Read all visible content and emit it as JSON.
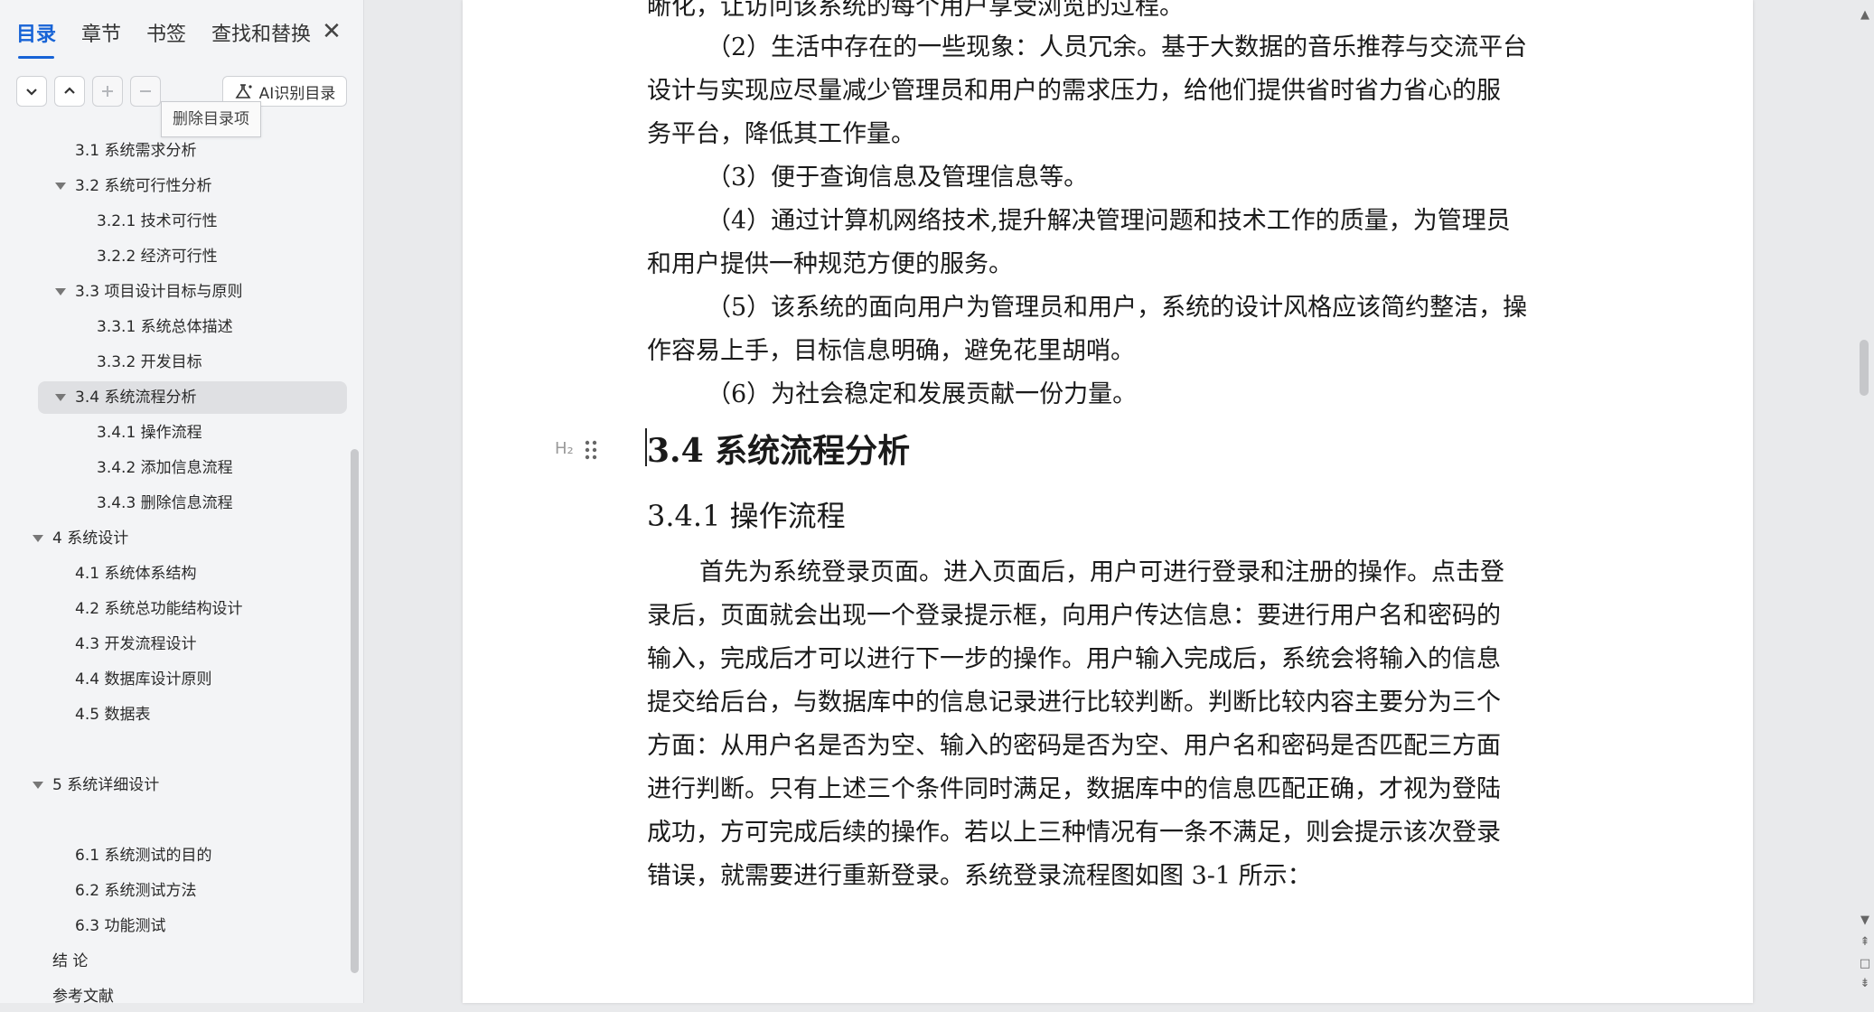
{
  "sidebar": {
    "tabs": [
      {
        "label": "目录",
        "active": true
      },
      {
        "label": "章节",
        "active": false
      },
      {
        "label": "书签",
        "active": false
      },
      {
        "label": "查找和替换",
        "active": false
      }
    ],
    "close_label": "✕",
    "ai_button_label": "AI识别目录",
    "tooltip": "删除目录项",
    "toc": [
      {
        "label": "3.1  系统需求分析",
        "level": 2,
        "has_arrow": false
      },
      {
        "label": "3.2  系统可行性分析",
        "level": 2,
        "has_arrow": true
      },
      {
        "label": "3.2.1 技术可行性",
        "level": 3,
        "has_arrow": false
      },
      {
        "label": "3.2.2 经济可行性",
        "level": 3,
        "has_arrow": false
      },
      {
        "label": "3.3  项目设计目标与原则",
        "level": 2,
        "has_arrow": true
      },
      {
        "label": "3.3.1 系统总体描述",
        "level": 3,
        "has_arrow": false
      },
      {
        "label": "3.3.2 开发目标",
        "level": 3,
        "has_arrow": false
      },
      {
        "label": "3.4 系统流程分析",
        "level": 2,
        "has_arrow": true,
        "selected": true
      },
      {
        "label": "3.4.1 操作流程",
        "level": 3,
        "has_arrow": false
      },
      {
        "label": "3.4.2 添加信息流程",
        "level": 3,
        "has_arrow": false
      },
      {
        "label": "3.4.3 删除信息流程",
        "level": 3,
        "has_arrow": false
      },
      {
        "label": "4  系统设计",
        "level": 1,
        "has_arrow": true
      },
      {
        "label": "4.1  系统体系结构",
        "level": 2,
        "has_arrow": false
      },
      {
        "label": "4.2  系统总功能结构设计",
        "level": 2,
        "has_arrow": false
      },
      {
        "label": "4.3 开发流程设计",
        "level": 2,
        "has_arrow": false
      },
      {
        "label": "4.4  数据库设计原则",
        "level": 2,
        "has_arrow": false
      },
      {
        "label": "4.5  数据表",
        "level": 2,
        "has_arrow": false
      },
      {
        "label": "5  系统详细设计",
        "level": 1,
        "has_arrow": true,
        "gap_before": true
      },
      {
        "label": "6.1 系统测试的目的",
        "level": 2,
        "has_arrow": false,
        "gap_before": true
      },
      {
        "label": "6.2 系统测试方法",
        "level": 2,
        "has_arrow": false
      },
      {
        "label": "6.3 功能测试",
        "level": 2,
        "has_arrow": false
      },
      {
        "label": "结    论",
        "level": 1,
        "has_arrow": false
      },
      {
        "label": "参考文献",
        "level": 1,
        "has_arrow": false
      }
    ]
  },
  "document": {
    "top_partial": "晰化，让访问该系统的每个用户享受浏览的过程。",
    "list_lines": [
      "（2）生活中存在的一些现象：人员冗余。基于大数据的音乐推荐与交流平台",
      "设计与实现应尽量减少管理员和用户的需求压力，给他们提供省时省力省心的服",
      "务平台，降低其工作量。",
      "（3）便于查询信息及管理信息等。",
      "（4）通过计算机网络技术,提升解决管理问题和技术工作的质量，为管理员",
      "和用户提供一种规范方便的服务。",
      "（5）该系统的面向用户为管理员和用户，系统的设计风格应该简约整洁，操",
      "作容易上手，目标信息明确，避免花里胡哨。",
      "（6）为社会稳定和发展贡献一份力量。"
    ],
    "heading_marker": "H₂",
    "heading2": "3.4 系统流程分析",
    "heading3": "3.4.1 操作流程",
    "body_lines": [
      "首先为系统登录页面。进入页面后，用户可进行登录和注册的操作。点击登",
      "录后，页面就会出现一个登录提示框，向用户传达信息：要进行用户名和密码的",
      "输入，完成后才可以进行下一步的操作。用户输入完成后，系统会将输入的信息",
      "提交给后台，与数据库中的信息记录进行比较判断。判断比较内容主要分为三个",
      "方面：从用户名是否为空、输入的密码是否为空、用户名和密码是否匹配三方面",
      "进行判断。只有上述三个条件同时满足，数据库中的信息匹配正确，才视为登陆",
      "成功，方可完成后续的操作。若以上三种情况有一条不满足，则会提示该次登录",
      "错误，就需要进行重新登录。系统登录流程图如图 3-1 所示："
    ]
  },
  "colors": {
    "accent": "#1763d6",
    "sidebar_bg": "#f3f4f6",
    "workspace_bg": "#e9eaec"
  }
}
